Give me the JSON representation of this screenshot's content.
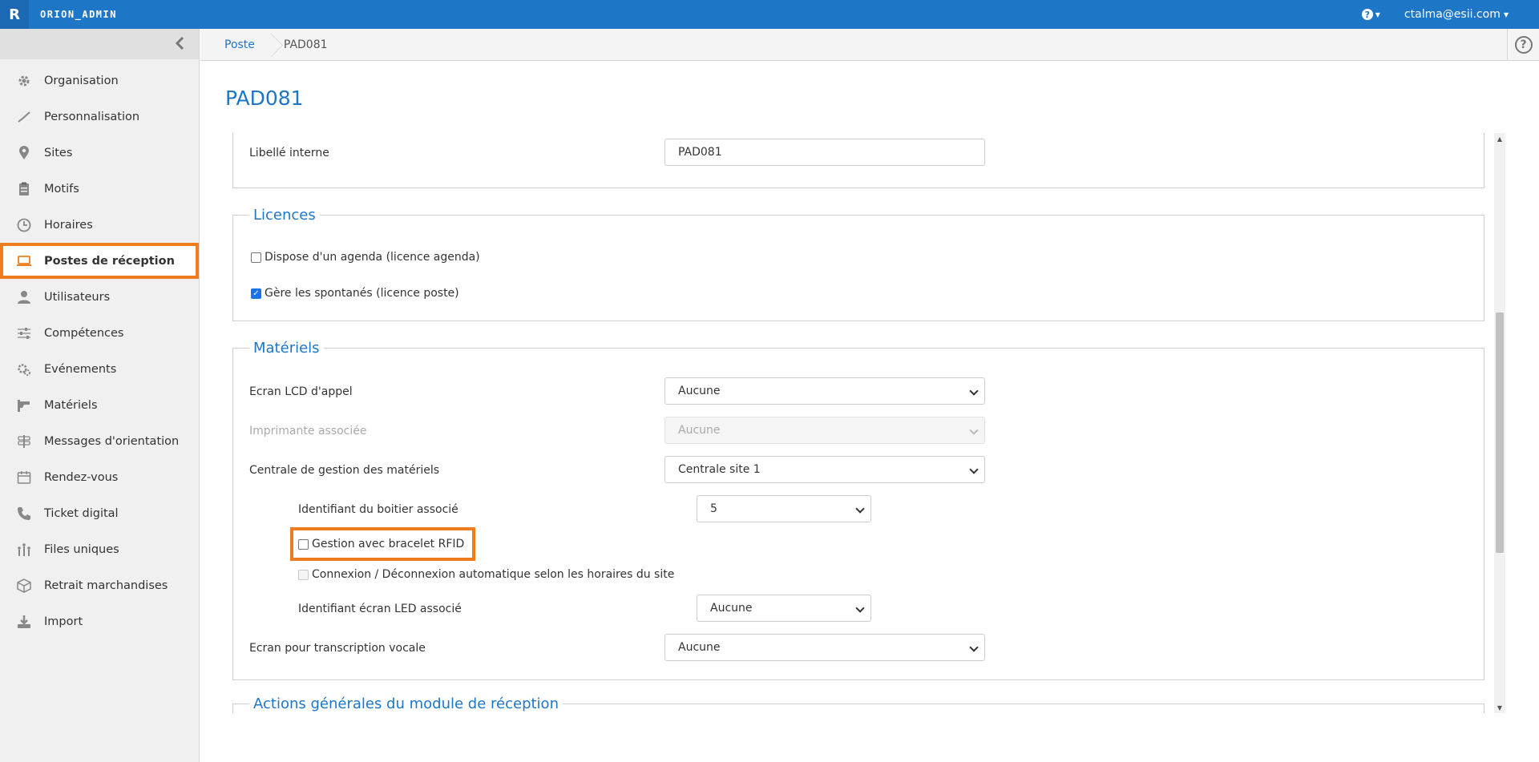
{
  "app": {
    "logo": "R",
    "title": "ORION_ADMIN",
    "user": "ctalma@esii.com"
  },
  "sidebar": {
    "items": [
      {
        "label": "Organisation",
        "icon": "gear-icon"
      },
      {
        "label": "Personnalisation",
        "icon": "brush-icon"
      },
      {
        "label": "Sites",
        "icon": "map-marker-icon"
      },
      {
        "label": "Motifs",
        "icon": "clipboard-icon"
      },
      {
        "label": "Horaires",
        "icon": "clock-icon"
      },
      {
        "label": "Postes de réception",
        "icon": "laptop-icon",
        "active": true
      },
      {
        "label": "Utilisateurs",
        "icon": "user-icon"
      },
      {
        "label": "Compétences",
        "icon": "sliders-icon"
      },
      {
        "label": "Evénements",
        "icon": "gears-icon"
      },
      {
        "label": "Matériels",
        "icon": "hardware-icon"
      },
      {
        "label": "Messages d'orientation",
        "icon": "signpost-icon"
      },
      {
        "label": "Rendez-vous",
        "icon": "calendar-icon"
      },
      {
        "label": "Ticket digital",
        "icon": "phone-icon"
      },
      {
        "label": "Files uniques",
        "icon": "queue-icon"
      },
      {
        "label": "Retrait marchandises",
        "icon": "box-icon"
      },
      {
        "label": "Import",
        "icon": "download-icon"
      }
    ]
  },
  "breadcrumb": {
    "root": "Poste",
    "current": "PAD081"
  },
  "page": {
    "title": "PAD081"
  },
  "form": {
    "libelle": {
      "label": "Libellé interne",
      "value": "PAD081"
    },
    "licences": {
      "legend": "Licences",
      "agenda": {
        "label": "Dispose d'un agenda (licence agenda)",
        "checked": false
      },
      "spontanes": {
        "label": "Gère les spontanés (licence poste)",
        "checked": true
      }
    },
    "materiels": {
      "legend": "Matériels",
      "ecran_lcd": {
        "label": "Ecran LCD d'appel",
        "value": "Aucune"
      },
      "imprimante": {
        "label": "Imprimante associée",
        "value": "Aucune"
      },
      "centrale": {
        "label": "Centrale de gestion des matériels",
        "value": "Centrale site 1"
      },
      "boitier": {
        "label": "Identifiant du boitier associé",
        "value": "5"
      },
      "rfid": {
        "label": "Gestion avec bracelet RFID",
        "checked": false
      },
      "connexion": {
        "label": "Connexion / Déconnexion automatique selon les horaires du site",
        "checked": false
      },
      "ecran_led": {
        "label": "Identifiant écran LED associé",
        "value": "Aucune"
      },
      "transcription": {
        "label": "Ecran pour transcription vocale",
        "value": "Aucune"
      }
    },
    "actions": {
      "legend": "Actions générales du module de réception"
    }
  },
  "colors": {
    "primary": "#1e76c7",
    "highlight": "#f07d1d"
  }
}
